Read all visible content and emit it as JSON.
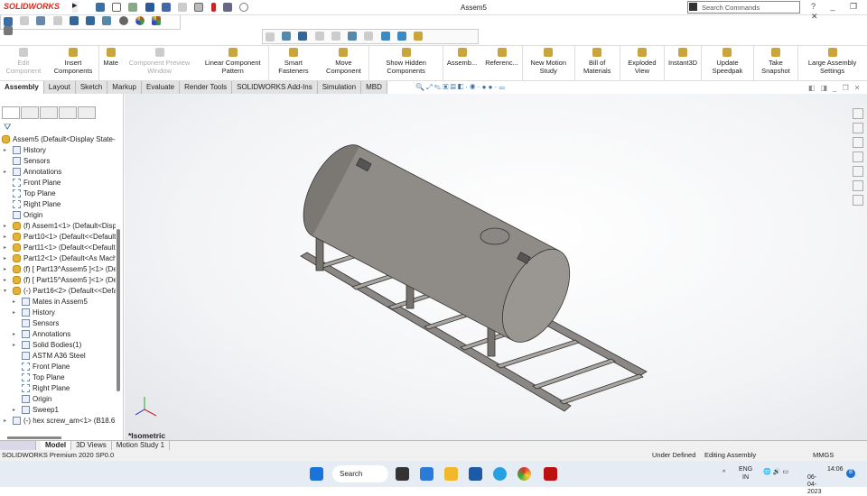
{
  "app": {
    "logo": "SOLIDWORKS",
    "title": "Assem5",
    "search_placeholder": "Search Commands",
    "window_controls": "? _ ❐ ✕"
  },
  "commands": [
    {
      "label": "Edit Component",
      "disabled": true
    },
    {
      "label": "Insert Components"
    },
    {
      "label": "Mate"
    },
    {
      "label": "Component Preview Window",
      "disabled": true
    },
    {
      "label": "Linear Component Pattern"
    },
    {
      "label": "Smart Fasteners"
    },
    {
      "label": "Move Component"
    },
    {
      "label": "Show Hidden Components"
    },
    {
      "label": "Assemb..."
    },
    {
      "label": "Referenc..."
    },
    {
      "label": "New Motion Study"
    },
    {
      "label": "Bill of Materials"
    },
    {
      "label": "Exploded View"
    },
    {
      "label": "Instant3D"
    },
    {
      "label": "Update Speedpak"
    },
    {
      "label": "Take Snapshot"
    },
    {
      "label": "Large Assembly Settings"
    }
  ],
  "tabs": [
    "Assembly",
    "Layout",
    "Sketch",
    "Markup",
    "Evaluate",
    "Render Tools",
    "SOLIDWORKS Add-Ins",
    "Simulation",
    "MBD"
  ],
  "tree": [
    {
      "label": "Assem5  (Default<Display State-1",
      "level": 0,
      "icon": "assembly"
    },
    {
      "label": "History",
      "level": 1,
      "exp": true,
      "icon": "folder"
    },
    {
      "label": "Sensors",
      "level": 1,
      "icon": "folder"
    },
    {
      "label": "Annotations",
      "level": 1,
      "exp": true,
      "icon": "folder"
    },
    {
      "label": "Front Plane",
      "level": 1,
      "icon": "plane"
    },
    {
      "label": "Top Plane",
      "level": 1,
      "icon": "plane"
    },
    {
      "label": "Right Plane",
      "level": 1,
      "icon": "plane"
    },
    {
      "label": "Origin",
      "level": 1,
      "icon": "origin"
    },
    {
      "label": "(f) Assem1<1> (Default<Displ",
      "level": 1,
      "exp": true,
      "icon": "part"
    },
    {
      "label": "Part10<1> (Default<<Default:",
      "level": 1,
      "exp": true,
      "icon": "part"
    },
    {
      "label": "Part11<1> (Default<<Default:",
      "level": 1,
      "exp": true,
      "icon": "part"
    },
    {
      "label": "Part12<1> (Default<As Machi",
      "level": 1,
      "exp": true,
      "icon": "part"
    },
    {
      "label": "(f) [ Part13^Assem5 ]<1> (Def",
      "level": 1,
      "exp": true,
      "icon": "part"
    },
    {
      "label": "(f) [ Part15^Assem5 ]<1> (Def",
      "level": 1,
      "exp": true,
      "icon": "part"
    },
    {
      "label": "(-) Part16<2> (Default<<Defa",
      "level": 1,
      "exp": true,
      "open": true,
      "icon": "part"
    },
    {
      "label": "Mates in Assem5",
      "level": 2,
      "exp": true,
      "icon": "folder"
    },
    {
      "label": "History",
      "level": 2,
      "exp": true,
      "icon": "folder"
    },
    {
      "label": "Sensors",
      "level": 2,
      "icon": "folder"
    },
    {
      "label": "Annotations",
      "level": 2,
      "exp": true,
      "icon": "folder"
    },
    {
      "label": "Solid Bodies(1)",
      "level": 2,
      "exp": true,
      "icon": "folder"
    },
    {
      "label": "ASTM A36 Steel",
      "level": 2,
      "icon": "material"
    },
    {
      "label": "Front Plane",
      "level": 2,
      "icon": "plane"
    },
    {
      "label": "Top Plane",
      "level": 2,
      "icon": "plane"
    },
    {
      "label": "Right Plane",
      "level": 2,
      "icon": "plane"
    },
    {
      "label": "Origin",
      "level": 2,
      "icon": "origin"
    },
    {
      "label": "Sweep1",
      "level": 2,
      "exp": true,
      "icon": "feature"
    },
    {
      "label": "(-) hex screw_am<1> (B18.6.7M",
      "level": 1,
      "exp": true,
      "icon": "screw"
    }
  ],
  "viewport": {
    "view_label": "*Isometric"
  },
  "bottom_tabs": [
    "Model",
    "3D Views",
    "Motion Study 1"
  ],
  "status": {
    "product": "SOLIDWORKS Premium 2020 SP0.0",
    "state": "Under Defined",
    "mode": "Editing Assembly",
    "units": "MMGS"
  },
  "taskbar": {
    "search": "Search",
    "lang1": "ENG",
    "lang2": "IN",
    "time": "14:06",
    "date": "06-04-2023",
    "badge": "8"
  }
}
